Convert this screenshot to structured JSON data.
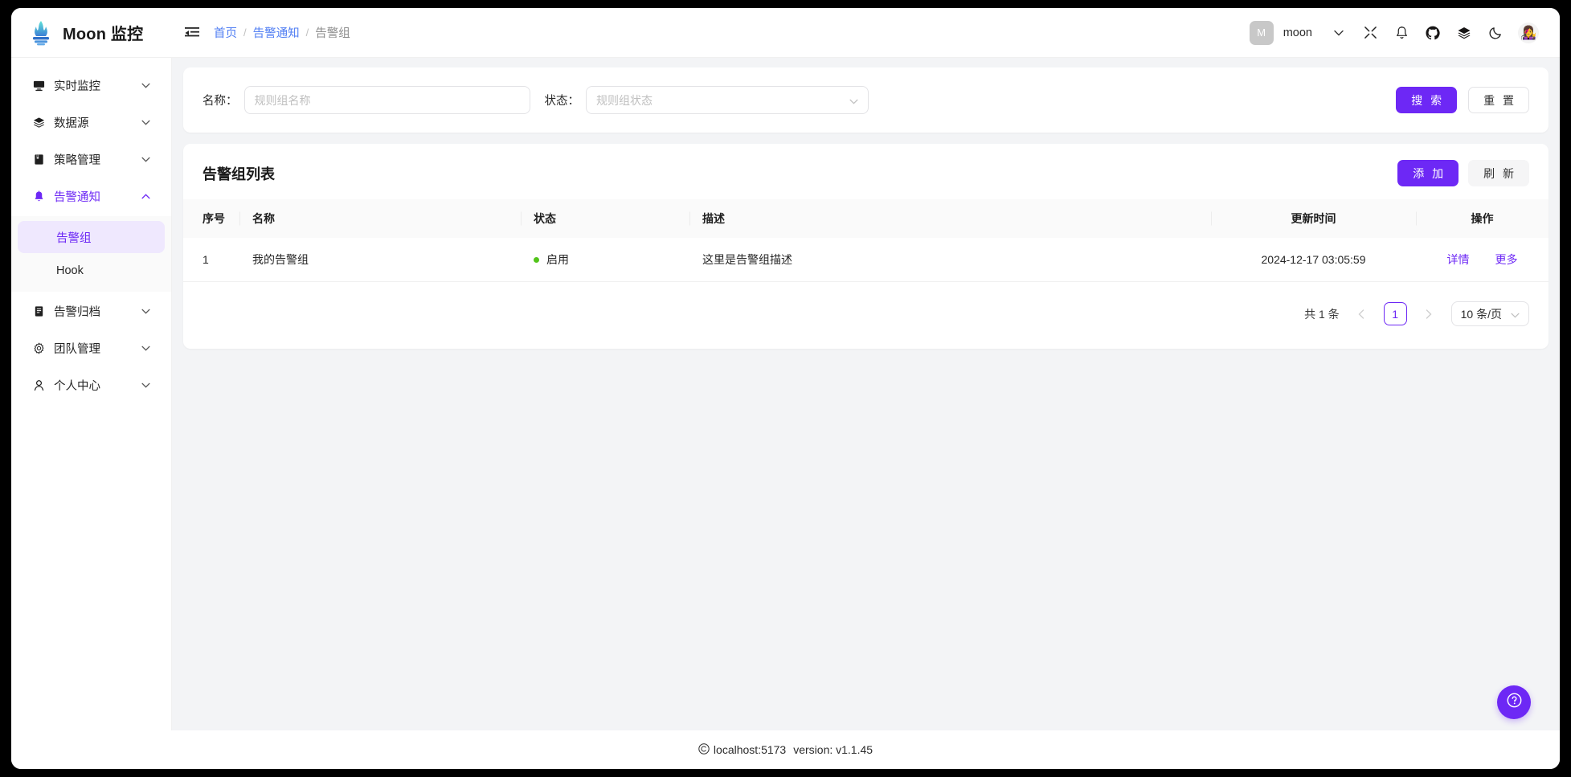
{
  "app": {
    "brand_title": "Moon 监控",
    "logo_icon": "flame-logo-icon"
  },
  "topbar": {
    "collapse_icon": "menu-collapse-icon",
    "breadcrumb": [
      {
        "label": "首页",
        "type": "link"
      },
      {
        "label": "告警通知",
        "type": "link"
      },
      {
        "label": "告警组",
        "type": "current"
      }
    ],
    "separator": "/",
    "avatar_initial": "M",
    "user_name": "moon",
    "icons": [
      {
        "name": "fullscreen-icon"
      },
      {
        "name": "bell-icon"
      },
      {
        "name": "github-icon"
      },
      {
        "name": "docs-layers-icon"
      },
      {
        "name": "dark-mode-moon-icon"
      }
    ],
    "profile_avatar": "👩‍🎤"
  },
  "sidebar": {
    "items": [
      {
        "label": "实时监控",
        "icon": "monitor-icon",
        "arrow": "chevron-down-icon",
        "active": false
      },
      {
        "label": "数据源",
        "icon": "database-layers-icon",
        "arrow": "chevron-down-icon",
        "active": false
      },
      {
        "label": "策略管理",
        "icon": "policy-book-icon",
        "arrow": "chevron-down-icon",
        "active": false
      },
      {
        "label": "告警通知",
        "icon": "bell-icon",
        "arrow": "chevron-up-icon",
        "active": true
      },
      {
        "label": "告警归档",
        "icon": "archive-icon",
        "arrow": "chevron-down-icon",
        "active": false
      },
      {
        "label": "团队管理",
        "icon": "gear-icon",
        "arrow": "chevron-down-icon",
        "active": false
      },
      {
        "label": "个人中心",
        "icon": "user-icon",
        "arrow": "chevron-down-icon",
        "active": false
      }
    ],
    "submenu": [
      {
        "label": "告警组",
        "selected": true
      },
      {
        "label": "Hook",
        "selected": false
      }
    ]
  },
  "search": {
    "name_label": "名称：",
    "name_placeholder": "规则组名称",
    "name_value": "",
    "status_label": "状态：",
    "status_placeholder": "规则组状态",
    "status_value": "",
    "search_button": "搜 索",
    "reset_button": "重 置"
  },
  "list": {
    "title": "告警组列表",
    "add_button": "添 加",
    "refresh_button": "刷 新",
    "columns": [
      "序号",
      "名称",
      "状态",
      "描述",
      "更新时间",
      "操作"
    ],
    "rows": [
      {
        "index": "1",
        "name": "我的告警组",
        "status": "启用",
        "status_color": "#52c41a",
        "description": "这里是告警组描述",
        "updated_at": "2024-12-17 03:05:59",
        "actions": [
          "详情",
          "更多"
        ]
      }
    ]
  },
  "pagination": {
    "total_text": "共 1 条",
    "prev_icon": "chevron-left-icon",
    "next_icon": "chevron-right-icon",
    "current_page": "1",
    "page_size_label": "10 条/页"
  },
  "footer": {
    "copyright_icon": "copyright-icon",
    "host": "localhost:5173",
    "version": "version: v1.1.45"
  },
  "help": {
    "icon": "question-circle-icon"
  },
  "colors": {
    "primary": "#6d28f5",
    "link": "#4f7df3",
    "success": "#52c41a",
    "page_bg": "#f3f4f6"
  }
}
